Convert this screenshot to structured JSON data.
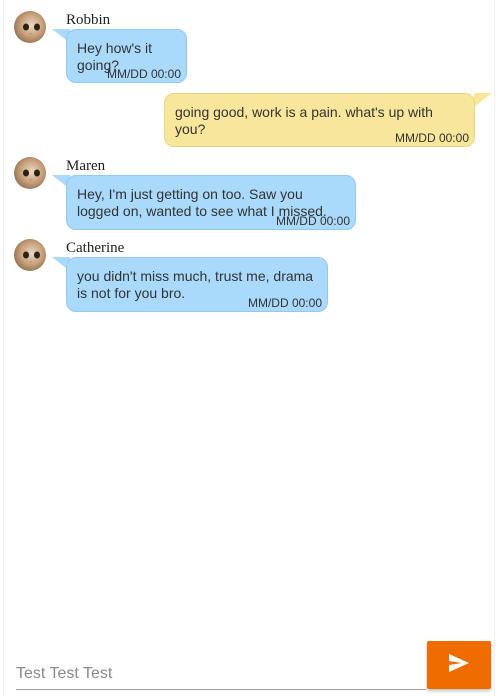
{
  "messages": [
    {
      "sender": "Robbin",
      "direction": "incoming",
      "text": "Hey how's it going?",
      "time": "MM/DD 00:00"
    },
    {
      "sender": "",
      "direction": "outgoing",
      "text": "going good, work is a pain. what's up with you?",
      "time": "MM/DD 00:00"
    },
    {
      "sender": "Maren",
      "direction": "incoming",
      "text": "Hey, I'm just getting on too. Saw you logged on, wanted to see what I missed.",
      "time": "MM/DD 00:00"
    },
    {
      "sender": "Catherine",
      "direction": "incoming",
      "text": "you didn't miss much, trust me, drama is not for you bro.",
      "time": "MM/DD 00:00"
    }
  ],
  "composer": {
    "placeholder": "Test Test Test",
    "value": "",
    "send_icon": "send-icon"
  },
  "colors": {
    "incoming_bubble": "#a9d9fb",
    "outgoing_bubble": "#f8e79a",
    "send_button": "#ef6c00"
  }
}
